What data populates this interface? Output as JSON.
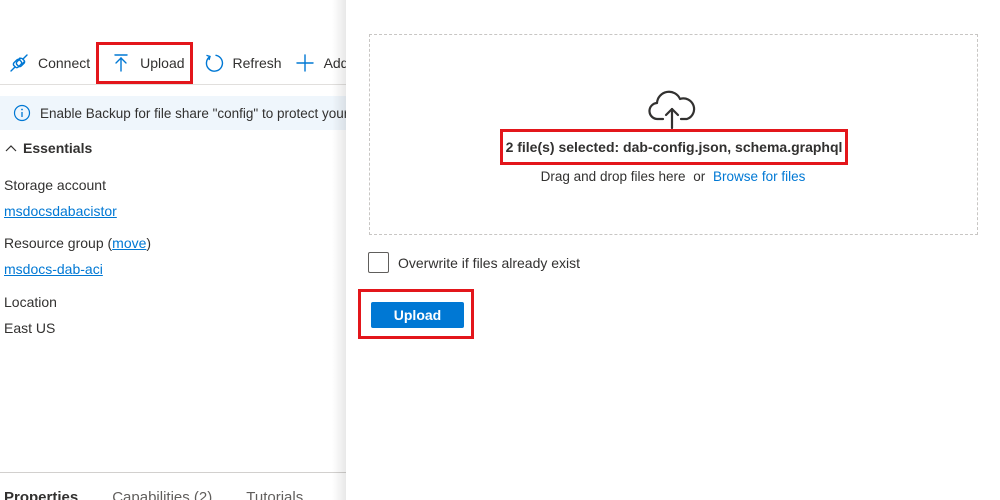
{
  "toolbar": {
    "items": [
      {
        "label": "Connect",
        "icon": "plug-icon"
      },
      {
        "label": "Upload",
        "icon": "upload-arrow-icon"
      },
      {
        "label": "Refresh",
        "icon": "refresh-icon"
      },
      {
        "label": "Add",
        "icon": "plus-icon"
      }
    ]
  },
  "banner": {
    "icon": "info-icon",
    "text": "Enable Backup for file share \"config\" to protect your"
  },
  "essentials": {
    "title": "Essentials",
    "storage_account_label": "Storage account",
    "storage_account_value": "msdocsdabacistor",
    "resource_group_label": "Resource group (",
    "resource_group_move": "move",
    "resource_group_close": ")",
    "resource_group_value": "msdocs-dab-aci",
    "location_label": "Location",
    "location_value": "East US"
  },
  "tabs": [
    {
      "label": "Properties",
      "active": true
    },
    {
      "label": "Capabilities (2)",
      "active": false
    },
    {
      "label": "Tutorials",
      "active": false
    }
  ],
  "upload_panel": {
    "cloud_icon": "cloud-upload-icon",
    "selected_text": "2 file(s) selected: dab-config.json, schema.graphql",
    "drag_text": "Drag and drop files here",
    "or_text": "or",
    "browse_link": "Browse for files",
    "overwrite_label": "Overwrite if files already exist",
    "overwrite_checked": false,
    "upload_button": "Upload"
  },
  "colors": {
    "accent": "#0078d4",
    "highlight": "#e3161b",
    "banner_bg": "#eff6fc"
  }
}
